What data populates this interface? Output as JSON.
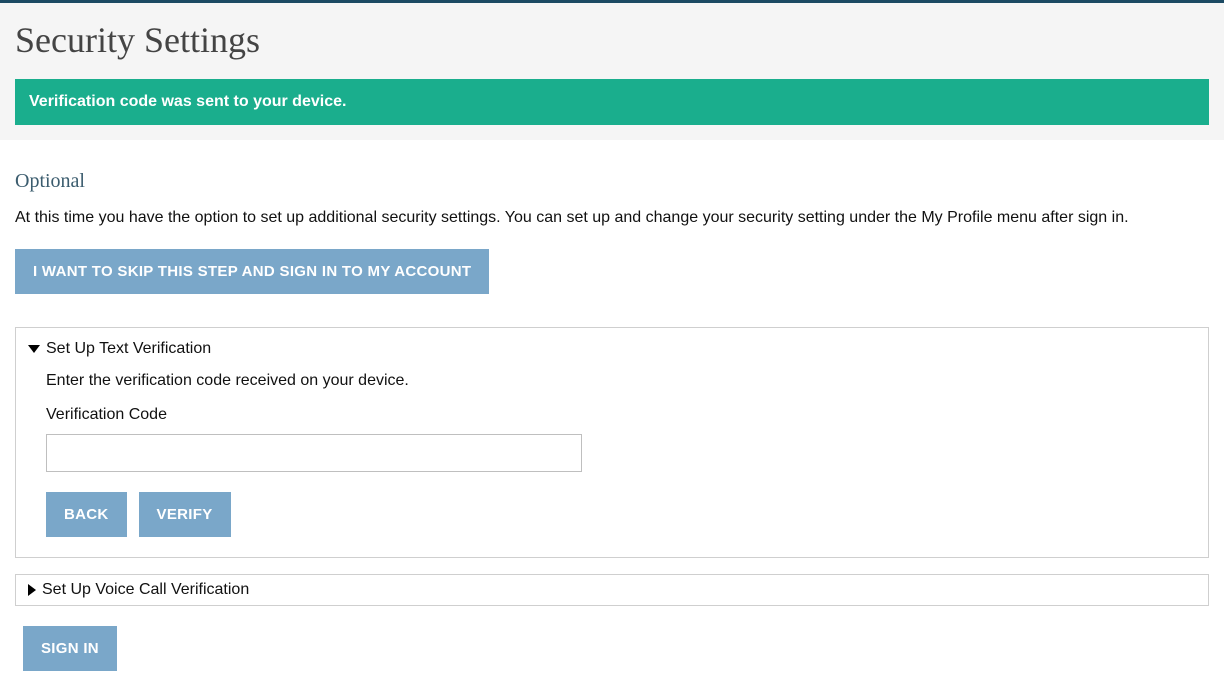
{
  "header": {
    "title": "Security Settings"
  },
  "alert": {
    "message": "Verification code was sent to your device."
  },
  "optional": {
    "heading": "Optional",
    "description": "At this time you have the option to set up additional security settings. You can set up and change your security setting under the My Profile menu after sign in.",
    "skip_label": "I WANT TO SKIP THIS STEP AND SIGN IN TO MY ACCOUNT"
  },
  "panel_text": {
    "title": "Set Up Text Verification",
    "instruction": "Enter the verification code received on your device.",
    "field_label": "Verification Code",
    "field_value": "",
    "back_label": "BACK",
    "verify_label": "VERIFY"
  },
  "panel_voice": {
    "title": "Set Up Voice Call Verification"
  },
  "signin": {
    "label": "SIGN IN"
  }
}
